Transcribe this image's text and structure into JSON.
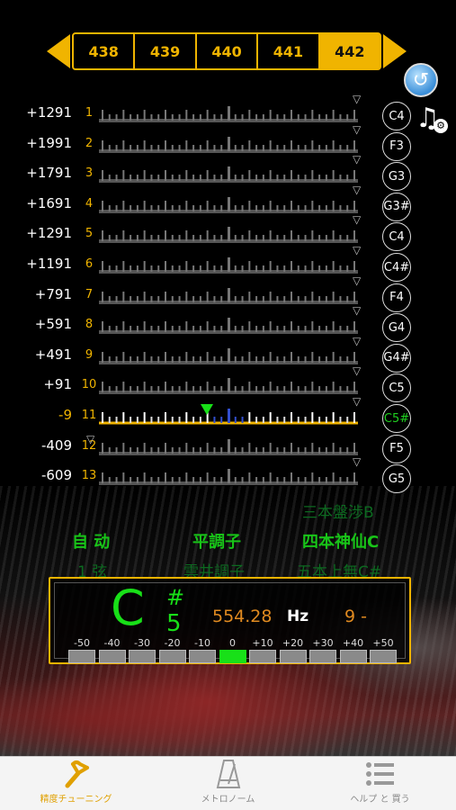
{
  "frequency_selector": {
    "options": [
      "438",
      "439",
      "440",
      "441",
      "442"
    ],
    "selected": "442"
  },
  "strings": [
    {
      "cents": "+1291",
      "number": "1",
      "note": "C4"
    },
    {
      "cents": "+1991",
      "number": "2",
      "note": "F3"
    },
    {
      "cents": "+1791",
      "number": "3",
      "note": "G3"
    },
    {
      "cents": "+1691",
      "number": "4",
      "note": "G3#"
    },
    {
      "cents": "+1291",
      "number": "5",
      "note": "C4"
    },
    {
      "cents": "+1191",
      "number": "6",
      "note": "C4#"
    },
    {
      "cents": "+791",
      "number": "7",
      "note": "F4"
    },
    {
      "cents": "+591",
      "number": "8",
      "note": "G4"
    },
    {
      "cents": "+491",
      "number": "9",
      "note": "G4#"
    },
    {
      "cents": "+91",
      "number": "10",
      "note": "C5"
    },
    {
      "cents": "-9",
      "number": "11",
      "note": "C5#"
    },
    {
      "cents": "-409",
      "number": "12",
      "note": "F5"
    },
    {
      "cents": "-609",
      "number": "13",
      "note": "G5"
    }
  ],
  "active_string_index": 10,
  "modes": {
    "row0_right": "三本盤渉B",
    "auto": "自 动",
    "tuning_name": "平調子",
    "preset": "四本神仙C",
    "string_dim": "1 弦",
    "tuning_dim": "雲井調子",
    "preset_dim": "五本上無C#"
  },
  "tuner": {
    "note": "C",
    "accidental": "#",
    "octave": "5",
    "frequency": "554.28",
    "unit": "Hz",
    "cents": "9 -",
    "meter_labels": [
      "-50",
      "-40",
      "-30",
      "-20",
      "-10",
      "0",
      "+10",
      "+20",
      "+30",
      "+40",
      "+50"
    ],
    "meter_active_index": 5
  },
  "tabs": [
    {
      "label": "精度チューニング",
      "icon": "tuning-fork-icon",
      "active": true
    },
    {
      "label": "メトロノーム",
      "icon": "metronome-icon",
      "active": false
    },
    {
      "label": "ヘルプ と 買う",
      "icon": "list-icon",
      "active": false
    }
  ],
  "colors": {
    "accent": "#f0b400",
    "active_green": "#18e018",
    "cent_orange": "#e08a20"
  }
}
